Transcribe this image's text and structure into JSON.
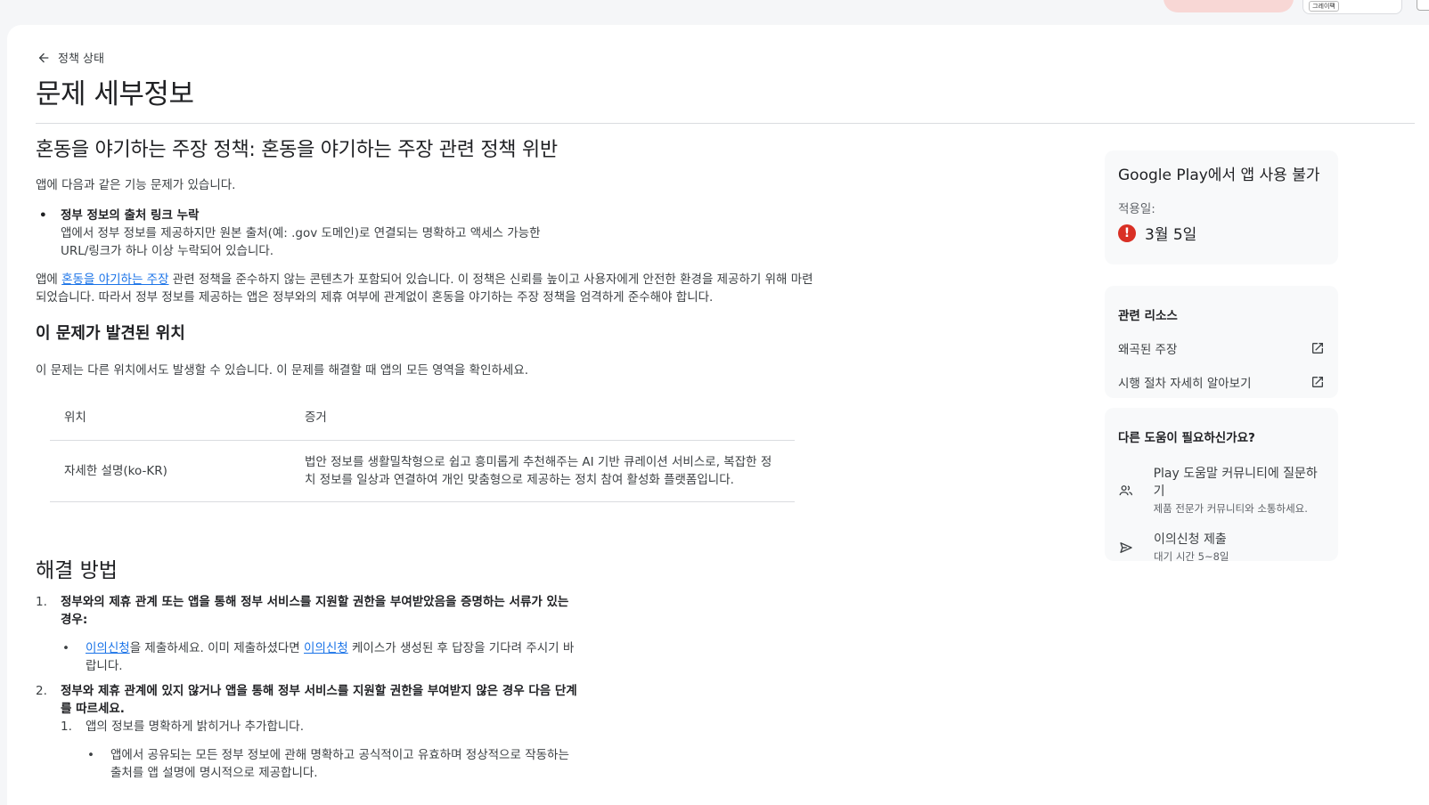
{
  "topbar": {
    "chip_logo": "그레이팩",
    "chip_text": ""
  },
  "back_label": "정책 상태",
  "page_title": "문제 세부정보",
  "issue": {
    "title": "혼동을 야기하는 주장 정책: 혼동을 야기하는 주장 관련 정책 위반",
    "intro": "앱에 다음과 같은 기능 문제가 있습니다.",
    "bullet_title": "정부 정보의 출처 링크 누락",
    "bullet_desc": "앱에서 정부 정보를 제공하지만 원본 출처(예: .gov 도메인)로 연결되는 명확하고 액세스 가능한 URL/링크가 하나 이상 누락되어 있습니다.",
    "policy_prefix": "앱에 ",
    "policy_link": "혼동을 야기하는 주장",
    "policy_suffix": " 관련 정책을 준수하지 않는 콘텐츠가 포함되어 있습니다. 이 정책은 신뢰를 높이고 사용자에게 안전한 환경을 제공하기 위해 마련되었습니다. 따라서 정부 정보를 제공하는 앱은 정부와의 제휴 여부에 관계없이 혼동을 야기하는 주장 정책을 엄격하게 준수해야 합니다."
  },
  "location": {
    "heading": "이 문제가 발견된 위치",
    "note": "이 문제는 다른 위치에서도 발생할 수 있습니다. 이 문제를 해결할 때 앱의 모든 영역을 확인하세요.",
    "col_location": "위치",
    "col_evidence": "증거",
    "row_location": "자세한 설명(ko-KR)",
    "row_evidence": "법안 정보를 생활밀착형으로 쉽고 흥미롭게 추천해주는 AI 기반 큐레이션 서비스로, 복잡한 정치 정보를 일상과 연결하여 개인 맞춤형으로 제공하는 정치 참여 활성화 플랫폼입니다."
  },
  "fix": {
    "heading": "해결 방법",
    "step1_num": "1.",
    "step1": "정부와의 제휴 관계 또는 앱을 통해 정부 서비스를 지원할 권한을 부여받았음을 증명하는 서류가 있는 경우:",
    "step1_link1": "이의신청",
    "step1_mid": "을 제출하세요. 이미 제출하셨다면 ",
    "step1_link2": "이의신청",
    "step1_end": " 케이스가 생성된 후 답장을 기다려 주시기 바랍니다.",
    "step2_num": "2.",
    "step2": "정부와 제휴 관계에 있지 않거나 앱을 통해 정부 서비스를 지원할 권한을 부여받지 않은 경우 다음 단계를 따르세요.",
    "sub1_num": "1.",
    "sub1": "앱의 정보를 명확하게 밝히거나 추가합니다.",
    "sub1_bullet": "앱에서 공유되는 모든 정부 정보에 관해 명확하고 공식적이고 유효하며 정상적으로 작동하는 출처를 앱 설명에 명시적으로 제공합니다."
  },
  "status_card": {
    "title": "Google Play에서 앱 사용 불가",
    "applied_label": "적용일:",
    "date": "3월 5일"
  },
  "resources": {
    "title": "관련 리소스",
    "items": [
      "왜곡된 주장",
      "시행 절차 자세히 알아보기"
    ]
  },
  "help": {
    "title": "다른 도움이 필요하신가요?",
    "community": "Play 도움말 커뮤니티에 질문하기",
    "community_sub": "제품 전문가 커뮤니티와 소통하세요.",
    "appeal": "이의신청 제출",
    "appeal_sub": "대기 시간 5~8일"
  },
  "colors": {
    "link": "#1a73e8",
    "error": "#d93025",
    "card_bg": "#f8f9fa"
  },
  "icons": [
    "arrow-back-icon",
    "error-icon",
    "open-in-new-icon",
    "people-icon",
    "send-icon"
  ]
}
